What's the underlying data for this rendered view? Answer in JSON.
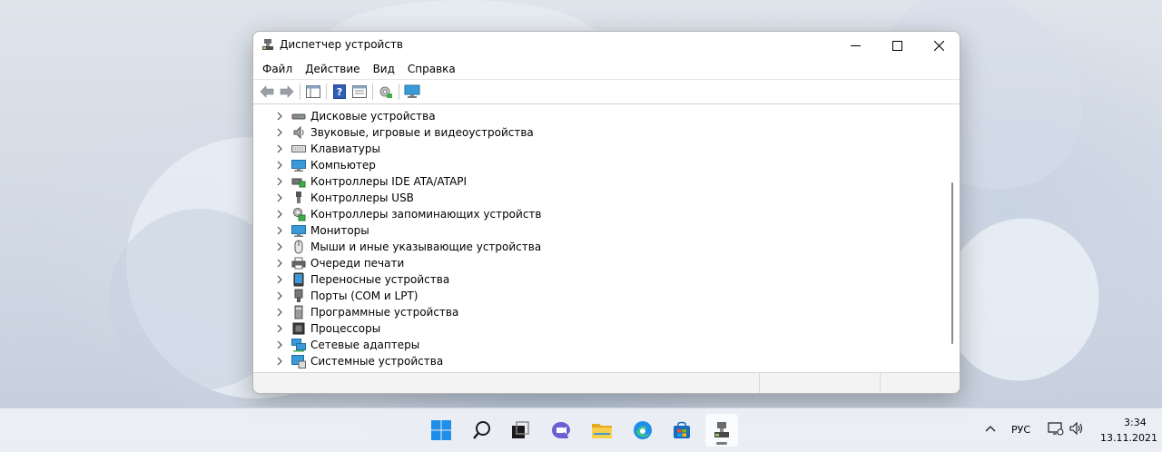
{
  "window": {
    "title": "Диспетчер устройств"
  },
  "menu": {
    "items": [
      "Файл",
      "Действие",
      "Вид",
      "Справка"
    ]
  },
  "tree": {
    "items": [
      {
        "label": "Дисковые устройства",
        "icon": "disk-drive-icon"
      },
      {
        "label": "Звуковые, игровые и видеоустройства",
        "icon": "speaker-icon"
      },
      {
        "label": "Клавиатуры",
        "icon": "keyboard-icon"
      },
      {
        "label": "Компьютер",
        "icon": "computer-icon"
      },
      {
        "label": "Контроллеры IDE ATA/ATAPI",
        "icon": "ide-controller-icon"
      },
      {
        "label": "Контроллеры USB",
        "icon": "usb-icon"
      },
      {
        "label": "Контроллеры запоминающих устройств",
        "icon": "storage-controller-icon"
      },
      {
        "label": "Мониторы",
        "icon": "monitor-icon"
      },
      {
        "label": "Мыши и иные указывающие устройства",
        "icon": "mouse-icon"
      },
      {
        "label": "Очереди печати",
        "icon": "printer-icon"
      },
      {
        "label": "Переносные устройства",
        "icon": "portable-device-icon"
      },
      {
        "label": "Порты (COM и LPT)",
        "icon": "port-icon"
      },
      {
        "label": "Программные устройства",
        "icon": "software-device-icon"
      },
      {
        "label": "Процессоры",
        "icon": "processor-icon"
      },
      {
        "label": "Сетевые адаптеры",
        "icon": "network-adapter-icon"
      },
      {
        "label": "Системные устройства",
        "icon": "system-device-icon"
      }
    ]
  },
  "tray": {
    "language": "РУС",
    "time": "3:34",
    "date": "13.11.2021"
  },
  "colors": {
    "accent": "#0067c0",
    "monitor_blue": "#3a9ad9"
  }
}
